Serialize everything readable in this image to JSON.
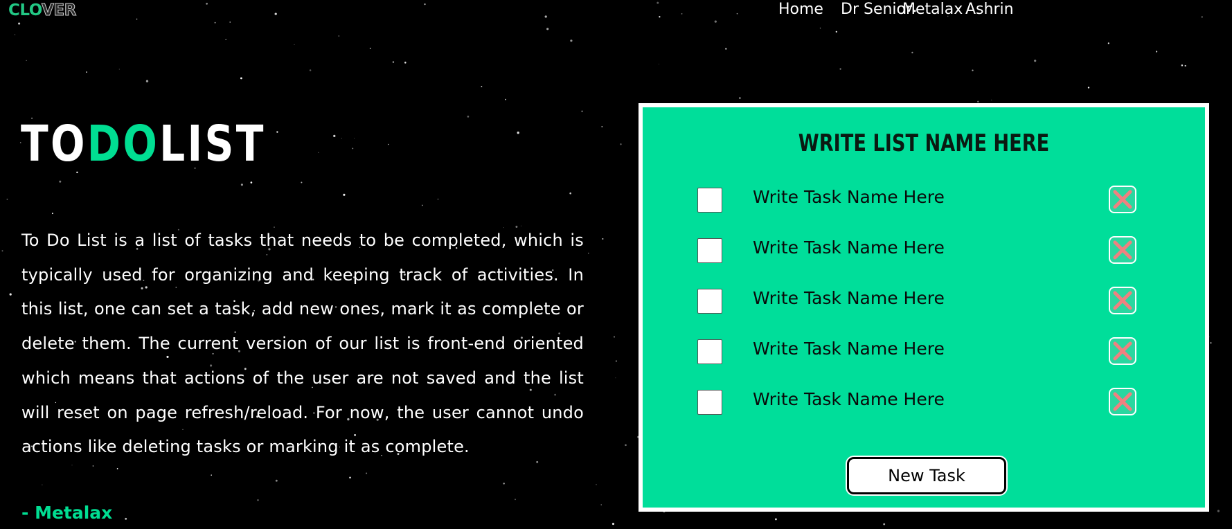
{
  "brand": {
    "part1": "CLO",
    "part2": "VER"
  },
  "nav": {
    "items": [
      {
        "label": "Home"
      },
      {
        "label": "Dr Senior"
      },
      {
        "label": "Metalax"
      },
      {
        "label": "Ashrin"
      }
    ]
  },
  "hero": {
    "title_part1": "TO",
    "title_part2": "DO",
    "title_part3": "LIST",
    "description": "To Do List is a list of tasks that needs to be completed, which is typically used for organizing and keeping track of activities. In this list, one can set a task, add new ones, mark it as complete or delete them. The current version of our list is front-end oriented which means that actions of the user are not saved and the list will reset on page refresh/reload. For now, the user cannot undo actions like deleting tasks or marking it as complete.",
    "author": "- Metalax"
  },
  "todo": {
    "list_name": "WRITE LIST NAME HERE",
    "tasks": [
      {
        "name": "Write Task Name Here",
        "checked": false
      },
      {
        "name": "Write Task Name Here",
        "checked": false
      },
      {
        "name": "Write Task Name Here",
        "checked": false
      },
      {
        "name": "Write Task Name Here",
        "checked": false
      },
      {
        "name": "Write Task Name Here",
        "checked": false
      }
    ],
    "new_task_label": "New Task"
  },
  "colors": {
    "accent": "#00de92",
    "card_bg": "#00de9a",
    "delete_icon": "#f08080",
    "background": "#000000"
  },
  "icons": {
    "delete": "close-x-icon"
  }
}
